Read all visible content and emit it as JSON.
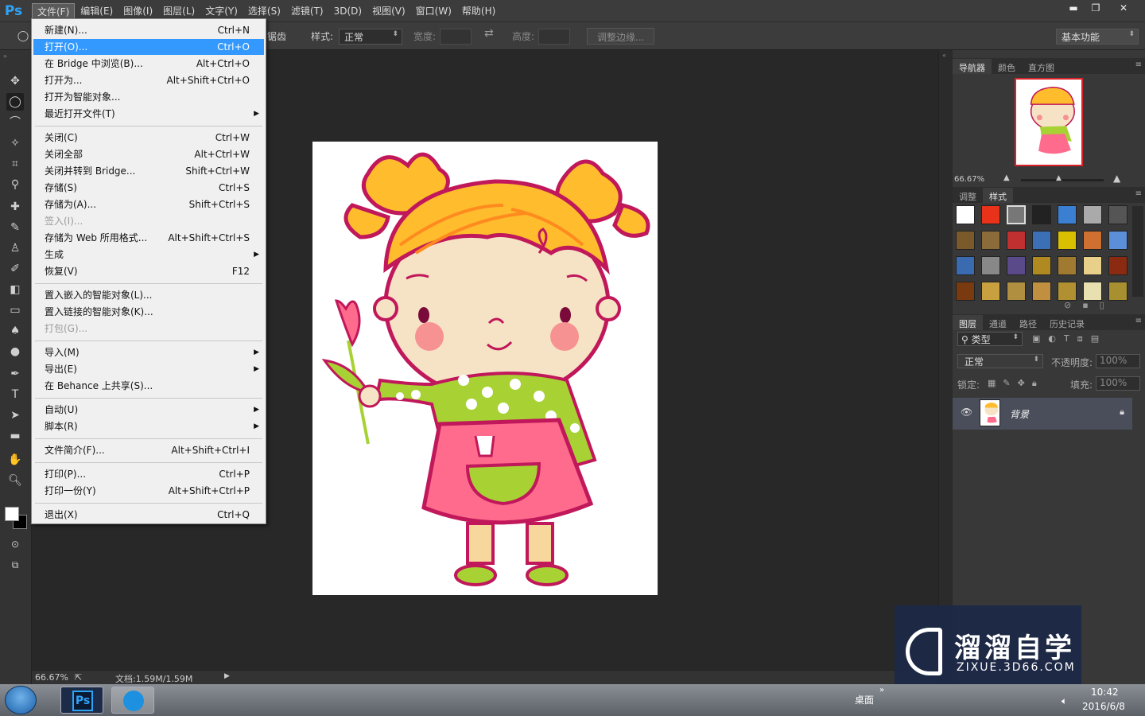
{
  "app": {
    "logo": "Ps"
  },
  "menubar": {
    "items": [
      "文件(F)",
      "编辑(E)",
      "图像(I)",
      "图层(L)",
      "文字(Y)",
      "选择(S)",
      "滤镜(T)",
      "3D(D)",
      "视图(V)",
      "窗口(W)",
      "帮助(H)"
    ],
    "open_index": 0
  },
  "window_controls": {
    "minimize": "▬",
    "restore": "❐",
    "close": "✕"
  },
  "options": {
    "feather_tail": "锯齿",
    "style_label": "样式:",
    "style_value": "正常",
    "width_label": "宽度:",
    "height_label": "高度:",
    "refine_edge": "调整边缘...",
    "workspace": "基本功能"
  },
  "file_menu": [
    {
      "label": "新建(N)...",
      "shortcut": "Ctrl+N"
    },
    {
      "label": "打开(O)...",
      "shortcut": "Ctrl+O",
      "highlight": true
    },
    {
      "label": "在 Bridge 中浏览(B)...",
      "shortcut": "Alt+Ctrl+O"
    },
    {
      "label": "打开为...",
      "shortcut": "Alt+Shift+Ctrl+O"
    },
    {
      "label": "打开为智能对象...",
      "shortcut": ""
    },
    {
      "label": "最近打开文件(T)",
      "shortcut": "",
      "submenu": true
    },
    {
      "sep": true
    },
    {
      "label": "关闭(C)",
      "shortcut": "Ctrl+W"
    },
    {
      "label": "关闭全部",
      "shortcut": "Alt+Ctrl+W"
    },
    {
      "label": "关闭并转到 Bridge...",
      "shortcut": "Shift+Ctrl+W"
    },
    {
      "label": "存储(S)",
      "shortcut": "Ctrl+S"
    },
    {
      "label": "存储为(A)...",
      "shortcut": "Shift+Ctrl+S"
    },
    {
      "label": "签入(I)...",
      "shortcut": "",
      "disabled": true
    },
    {
      "label": "存储为 Web 所用格式...",
      "shortcut": "Alt+Shift+Ctrl+S"
    },
    {
      "label": "生成",
      "shortcut": "",
      "submenu": true
    },
    {
      "label": "恢复(V)",
      "shortcut": "F12"
    },
    {
      "sep": true
    },
    {
      "label": "置入嵌入的智能对象(L)...",
      "shortcut": ""
    },
    {
      "label": "置入链接的智能对象(K)...",
      "shortcut": ""
    },
    {
      "label": "打包(G)...",
      "shortcut": "",
      "disabled": true
    },
    {
      "sep": true
    },
    {
      "label": "导入(M)",
      "shortcut": "",
      "submenu": true
    },
    {
      "label": "导出(E)",
      "shortcut": "",
      "submenu": true
    },
    {
      "label": "在 Behance 上共享(S)...",
      "shortcut": ""
    },
    {
      "sep": true
    },
    {
      "label": "自动(U)",
      "shortcut": "",
      "submenu": true
    },
    {
      "label": "脚本(R)",
      "shortcut": "",
      "submenu": true
    },
    {
      "sep": true
    },
    {
      "label": "文件简介(F)...",
      "shortcut": "Alt+Shift+Ctrl+I"
    },
    {
      "sep": true
    },
    {
      "label": "打印(P)...",
      "shortcut": "Ctrl+P"
    },
    {
      "label": "打印一份(Y)",
      "shortcut": "Alt+Shift+Ctrl+P"
    },
    {
      "sep": true
    },
    {
      "label": "退出(X)",
      "shortcut": "Ctrl+Q"
    }
  ],
  "navigator": {
    "tabs": [
      "导航器",
      "颜色",
      "直方图"
    ],
    "zoom": "66.67%"
  },
  "styles": {
    "tabs": [
      "调整",
      "样式"
    ]
  },
  "layers": {
    "tabs": [
      "图层",
      "通道",
      "路径",
      "历史记录"
    ],
    "filter": "类型",
    "blend_mode": "正常",
    "opacity_label": "不透明度:",
    "opacity": "100%",
    "lock_label": "锁定:",
    "fill_label": "填充:",
    "fill": "100%",
    "layer_name": "背景"
  },
  "status": {
    "zoom": "66.67%",
    "doc": "文档:1.59M/1.59M"
  },
  "taskbar": {
    "desktop": "桌面",
    "time": "10:42",
    "date": "2016/6/8"
  },
  "watermark": {
    "title": "溜溜自学",
    "subtitle": "ZIXUE.3D66.COM"
  }
}
